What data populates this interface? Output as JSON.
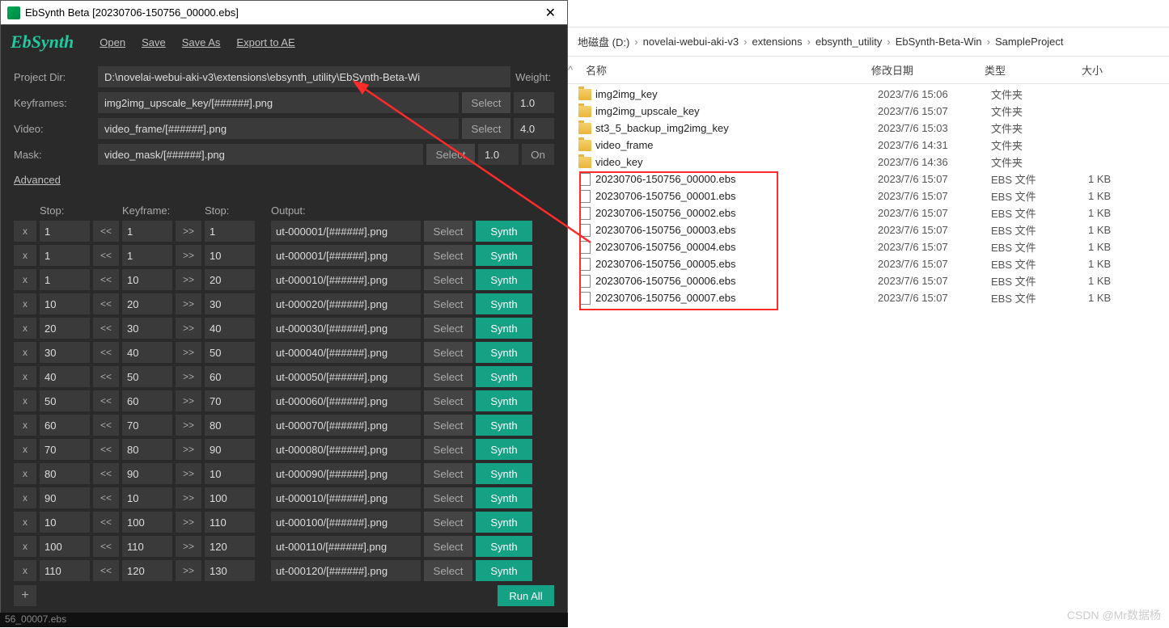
{
  "title": "EbSynth Beta [20230706-150756_00000.ebs]",
  "logo": "EbSynth",
  "menu": {
    "open": "Open",
    "save": "Save",
    "saveas": "Save As",
    "export": "Export to AE"
  },
  "labels": {
    "projectdir": "Project Dir:",
    "keyframes": "Keyframes:",
    "video": "Video:",
    "mask": "Mask:",
    "weight": "Weight:",
    "advanced": "Advanced",
    "select": "Select",
    "on": "On",
    "synth": "Synth",
    "runall": "Run All",
    "add": "+",
    "x": "x",
    "ll": "<<",
    "rr": ">>"
  },
  "paths": {
    "projectdir": "D:\\novelai-webui-aki-v3\\extensions\\ebsynth_utility\\EbSynth-Beta-Wi",
    "keyframes": "img2img_upscale_key/[######].png",
    "video": "video_frame/[######].png",
    "mask": "video_mask/[######].png"
  },
  "weights": {
    "kf": "1.0",
    "video": "4.0",
    "mask": "1.0"
  },
  "tablehead": {
    "stop1": "Stop:",
    "keyframe": "Keyframe:",
    "stop2": "Stop:",
    "output": "Output:"
  },
  "rows": [
    {
      "s1": "1",
      "kf": "1",
      "s2": "1",
      "out": "ut-000001/[######].png"
    },
    {
      "s1": "1",
      "kf": "1",
      "s2": "10",
      "out": "ut-000001/[######].png"
    },
    {
      "s1": "1",
      "kf": "10",
      "s2": "20",
      "out": "ut-000010/[######].png"
    },
    {
      "s1": "10",
      "kf": "20",
      "s2": "30",
      "out": "ut-000020/[######].png"
    },
    {
      "s1": "20",
      "kf": "30",
      "s2": "40",
      "out": "ut-000030/[######].png"
    },
    {
      "s1": "30",
      "kf": "40",
      "s2": "50",
      "out": "ut-000040/[######].png"
    },
    {
      "s1": "40",
      "kf": "50",
      "s2": "60",
      "out": "ut-000050/[######].png"
    },
    {
      "s1": "50",
      "kf": "60",
      "s2": "70",
      "out": "ut-000060/[######].png"
    },
    {
      "s1": "60",
      "kf": "70",
      "s2": "80",
      "out": "ut-000070/[######].png"
    },
    {
      "s1": "70",
      "kf": "80",
      "s2": "90",
      "out": "ut-000080/[######].png"
    },
    {
      "s1": "80",
      "kf": "90",
      "s2": "10",
      "out": "ut-000090/[######].png"
    },
    {
      "s1": "90",
      "kf": "10",
      "s2": "100",
      "out": "ut-000010/[######].png"
    },
    {
      "s1": "10",
      "kf": "100",
      "s2": "110",
      "out": "ut-000100/[######].png"
    },
    {
      "s1": "100",
      "kf": "110",
      "s2": "120",
      "out": "ut-000110/[######].png"
    },
    {
      "s1": "110",
      "kf": "120",
      "s2": "130",
      "out": "ut-000120/[######].png"
    }
  ],
  "bottombar": "56_00007.ebs",
  "breadcrumb": [
    "地磁盘 (D:)",
    "novelai-webui-aki-v3",
    "extensions",
    "ebsynth_utility",
    "EbSynth-Beta-Win",
    "SampleProject"
  ],
  "columns": {
    "name": "名称",
    "date": "修改日期",
    "type": "类型",
    "size": "大小"
  },
  "folders": [
    {
      "name": "img2img_key",
      "date": "2023/7/6 15:06",
      "type": "文件夹",
      "size": ""
    },
    {
      "name": "img2img_upscale_key",
      "date": "2023/7/6 15:07",
      "type": "文件夹",
      "size": ""
    },
    {
      "name": "st3_5_backup_img2img_key",
      "date": "2023/7/6 15:03",
      "type": "文件夹",
      "size": ""
    },
    {
      "name": "video_frame",
      "date": "2023/7/6 14:31",
      "type": "文件夹",
      "size": ""
    },
    {
      "name": "video_key",
      "date": "2023/7/6 14:36",
      "type": "文件夹",
      "size": ""
    }
  ],
  "files": [
    {
      "name": "20230706-150756_00000.ebs",
      "date": "2023/7/6 15:07",
      "type": "EBS 文件",
      "size": "1 KB"
    },
    {
      "name": "20230706-150756_00001.ebs",
      "date": "2023/7/6 15:07",
      "type": "EBS 文件",
      "size": "1 KB"
    },
    {
      "name": "20230706-150756_00002.ebs",
      "date": "2023/7/6 15:07",
      "type": "EBS 文件",
      "size": "1 KB"
    },
    {
      "name": "20230706-150756_00003.ebs",
      "date": "2023/7/6 15:07",
      "type": "EBS 文件",
      "size": "1 KB"
    },
    {
      "name": "20230706-150756_00004.ebs",
      "date": "2023/7/6 15:07",
      "type": "EBS 文件",
      "size": "1 KB"
    },
    {
      "name": "20230706-150756_00005.ebs",
      "date": "2023/7/6 15:07",
      "type": "EBS 文件",
      "size": "1 KB"
    },
    {
      "name": "20230706-150756_00006.ebs",
      "date": "2023/7/6 15:07",
      "type": "EBS 文件",
      "size": "1 KB"
    },
    {
      "name": "20230706-150756_00007.ebs",
      "date": "2023/7/6 15:07",
      "type": "EBS 文件",
      "size": "1 KB"
    }
  ],
  "watermark": "CSDN @Mr数据杨"
}
